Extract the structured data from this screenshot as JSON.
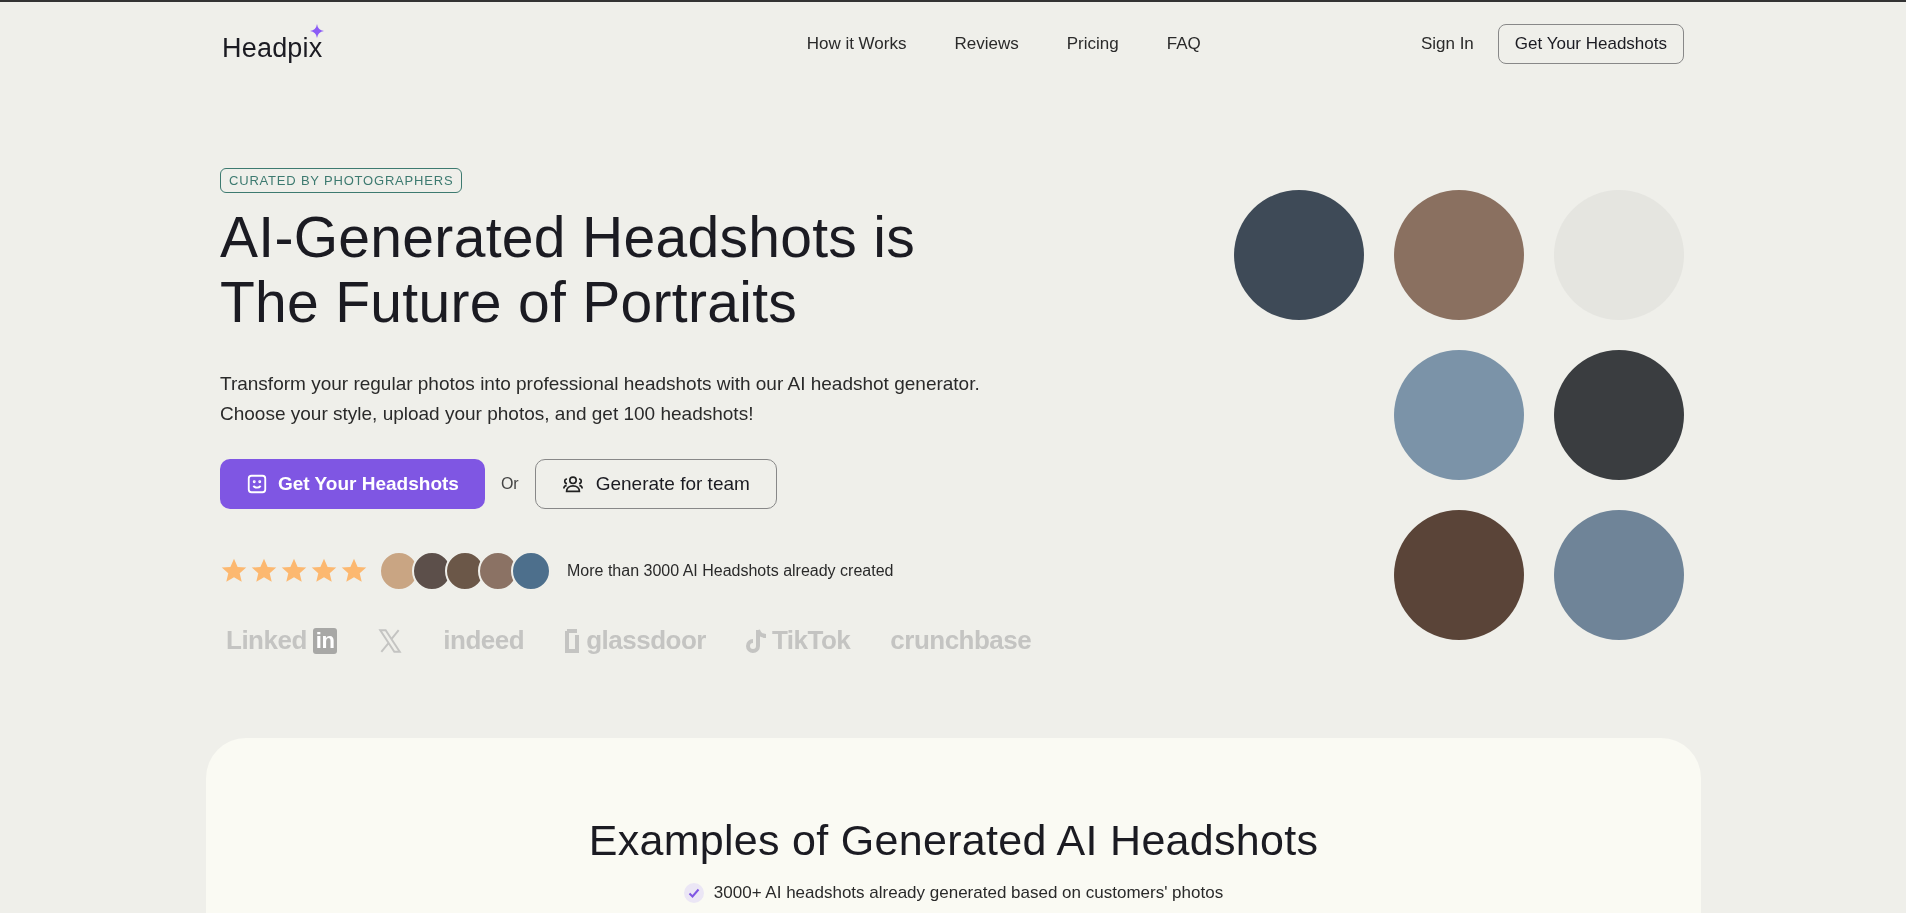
{
  "header": {
    "logo": "Headpix",
    "nav": [
      "How it Works",
      "Reviews",
      "Pricing",
      "FAQ"
    ],
    "sign_in": "Sign In",
    "cta": "Get Your Headshots"
  },
  "hero": {
    "badge": "CURATED BY PHOTOGRAPHERS",
    "title_lines": [
      "AI-Generated Headshots is",
      "The Future of Portraits"
    ],
    "description_lines": [
      "Transform your regular photos into professional headshots with our AI headshot generator.",
      "Choose your style, upload your photos, and get 100 headshots!"
    ],
    "primary_button": "Get Your Headshots",
    "or": "Or",
    "secondary_button": "Generate for team",
    "rating": {
      "stars": 5,
      "caption": "More than 3000 AI Headshots already created"
    },
    "logos": [
      {
        "kind": "split",
        "label": "Linked",
        "suffix": "in"
      },
      {
        "kind": "x-mark"
      },
      {
        "kind": "word",
        "label": "indeed"
      },
      {
        "kind": "door-word",
        "label": "glassdoor"
      },
      {
        "kind": "note-word",
        "label": "TikTok"
      },
      {
        "kind": "word",
        "label": "crunchbase"
      }
    ],
    "portraits": [
      {
        "faded": false
      },
      {
        "faded": false
      },
      {
        "faded": true
      },
      {
        "faded": false
      },
      {
        "faded": false
      },
      {
        "faded": false
      },
      {
        "faded": false
      }
    ]
  },
  "examples": {
    "title": "Examples of Generated AI Headshots",
    "points": [
      "3000+ AI headshots already generated based on customers' photos"
    ]
  }
}
